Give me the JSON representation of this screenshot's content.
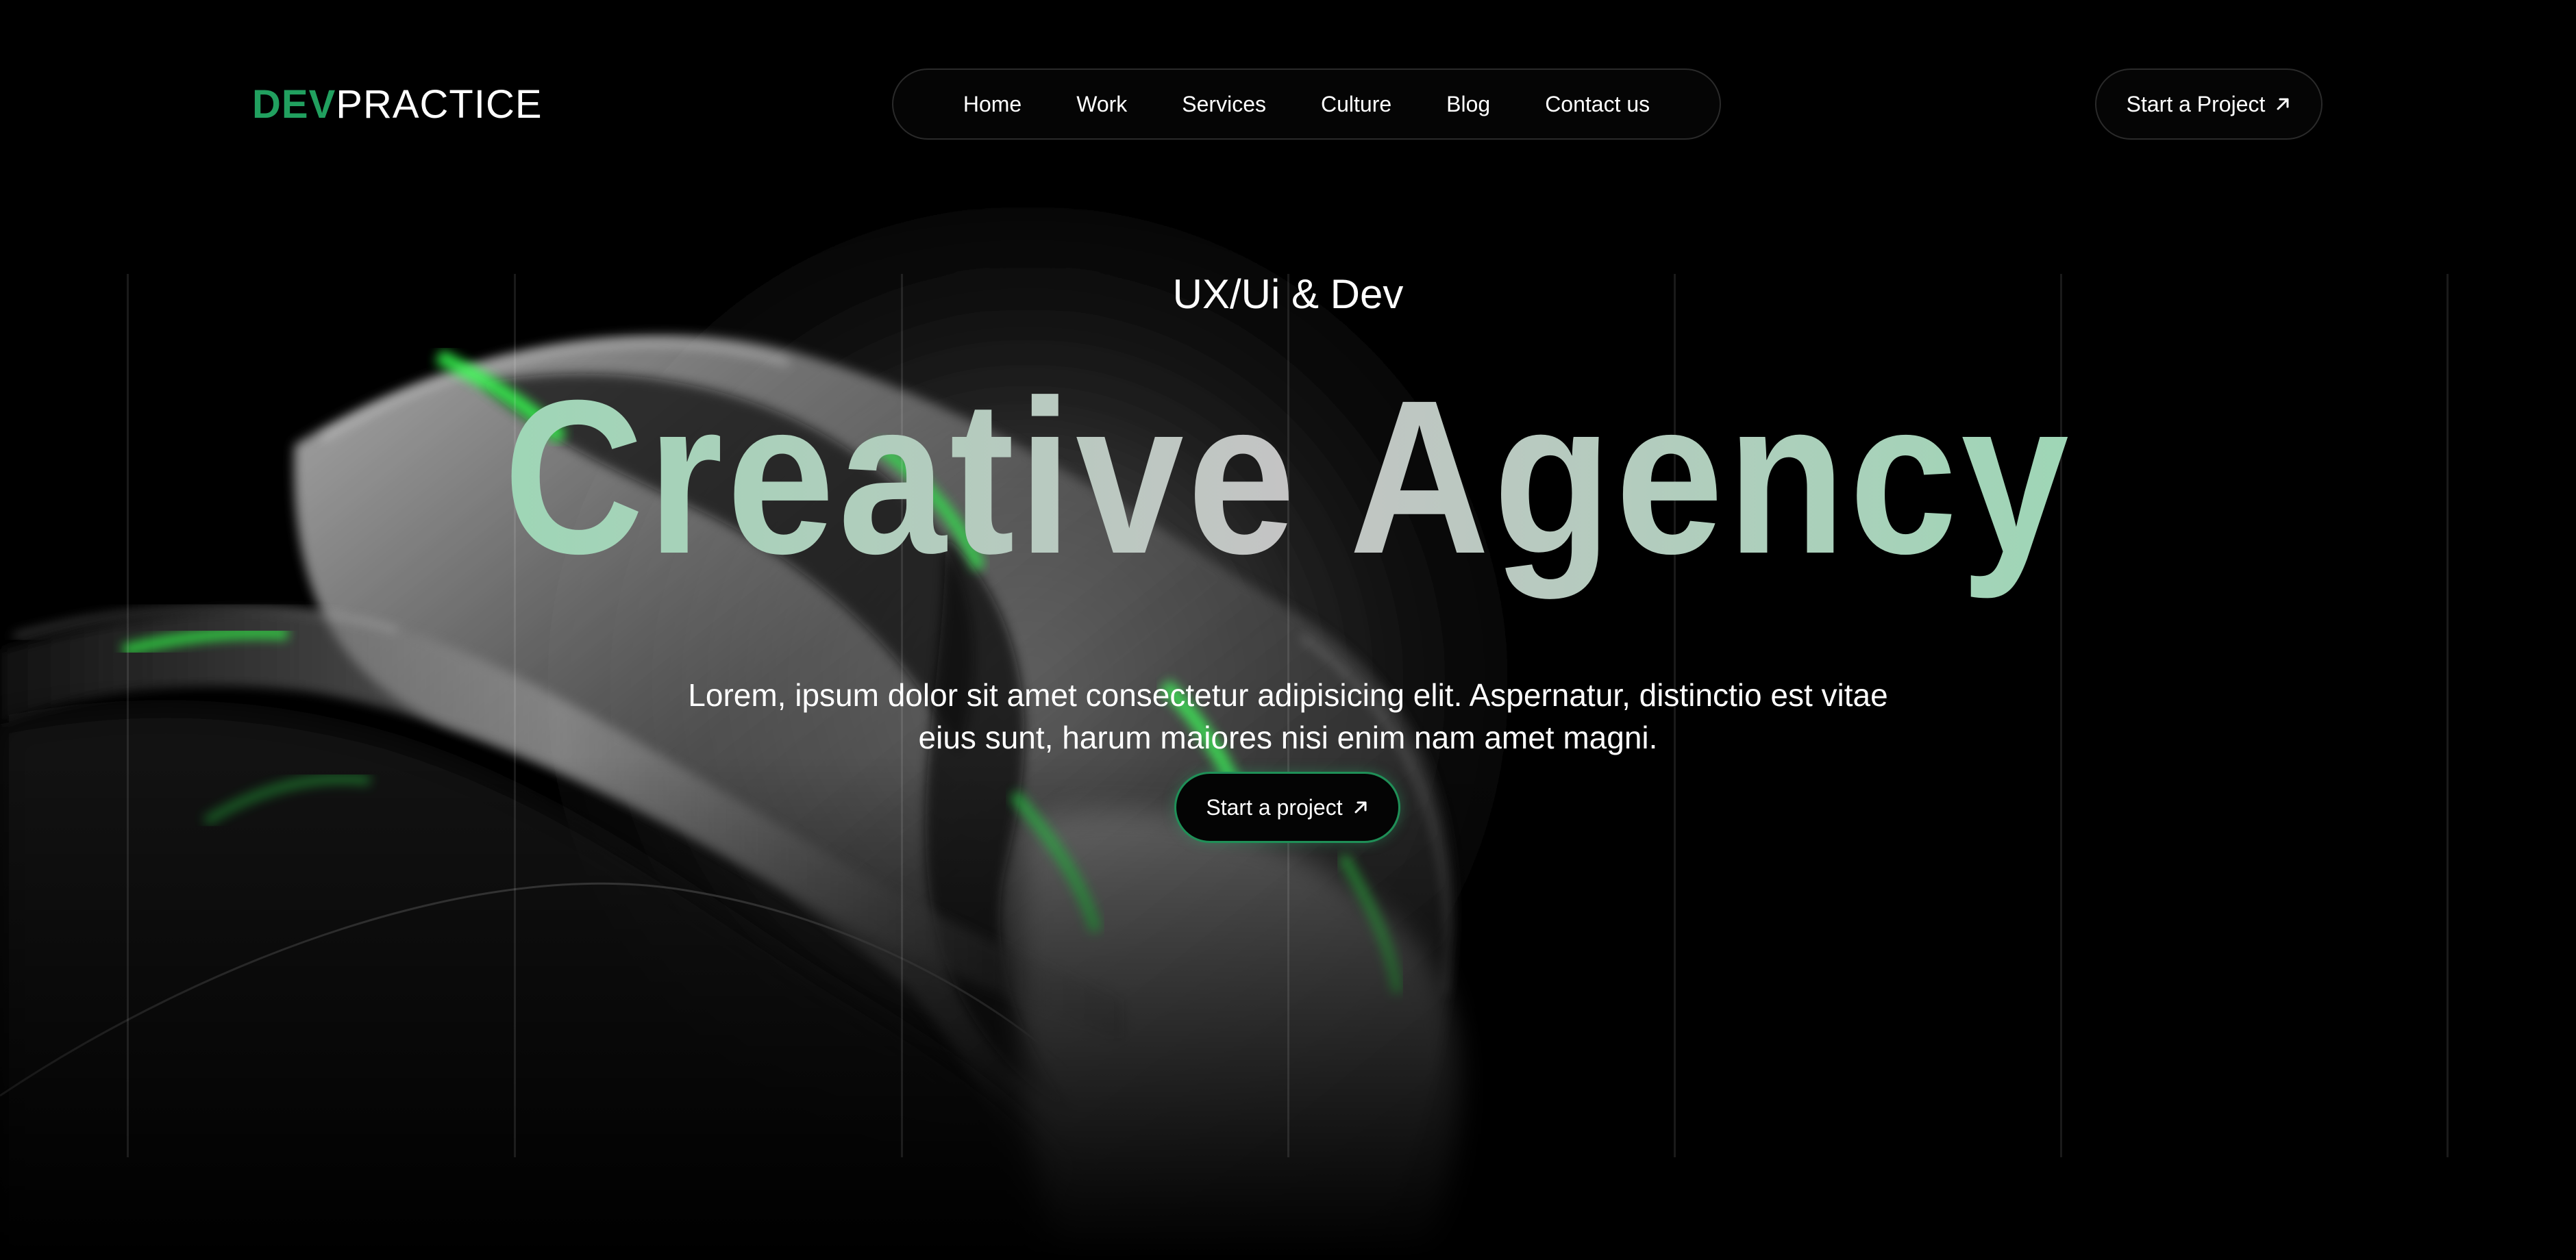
{
  "brand": {
    "accent_text": "DEV",
    "main_text": "PRACTICE",
    "accent_color": "#21a05f"
  },
  "nav": {
    "items": [
      {
        "label": "Home"
      },
      {
        "label": "Work"
      },
      {
        "label": "Services"
      },
      {
        "label": "Culture"
      },
      {
        "label": "Blog"
      },
      {
        "label": "Contact us"
      }
    ]
  },
  "header_cta": {
    "label": "Start a Project",
    "icon": "arrow-up-right-icon"
  },
  "hero": {
    "subtitle": "UX/Ui & Dev",
    "headline": "Creative Agency",
    "headline_gradient": [
      "#9ed6b6",
      "#c4c4c4",
      "#9ed6b6"
    ],
    "description": "Lorem, ipsum dolor sit amet consectetur adipisicing elit. Aspernatur, distinctio est vitae eius sunt, harum maiores nisi enim nam amet magni.",
    "cta_label": "Start a project",
    "cta_icon": "arrow-up-right-icon",
    "cta_border_color": "#1f8f57"
  },
  "theme": {
    "background": "#000000",
    "text": "#ffffff"
  }
}
